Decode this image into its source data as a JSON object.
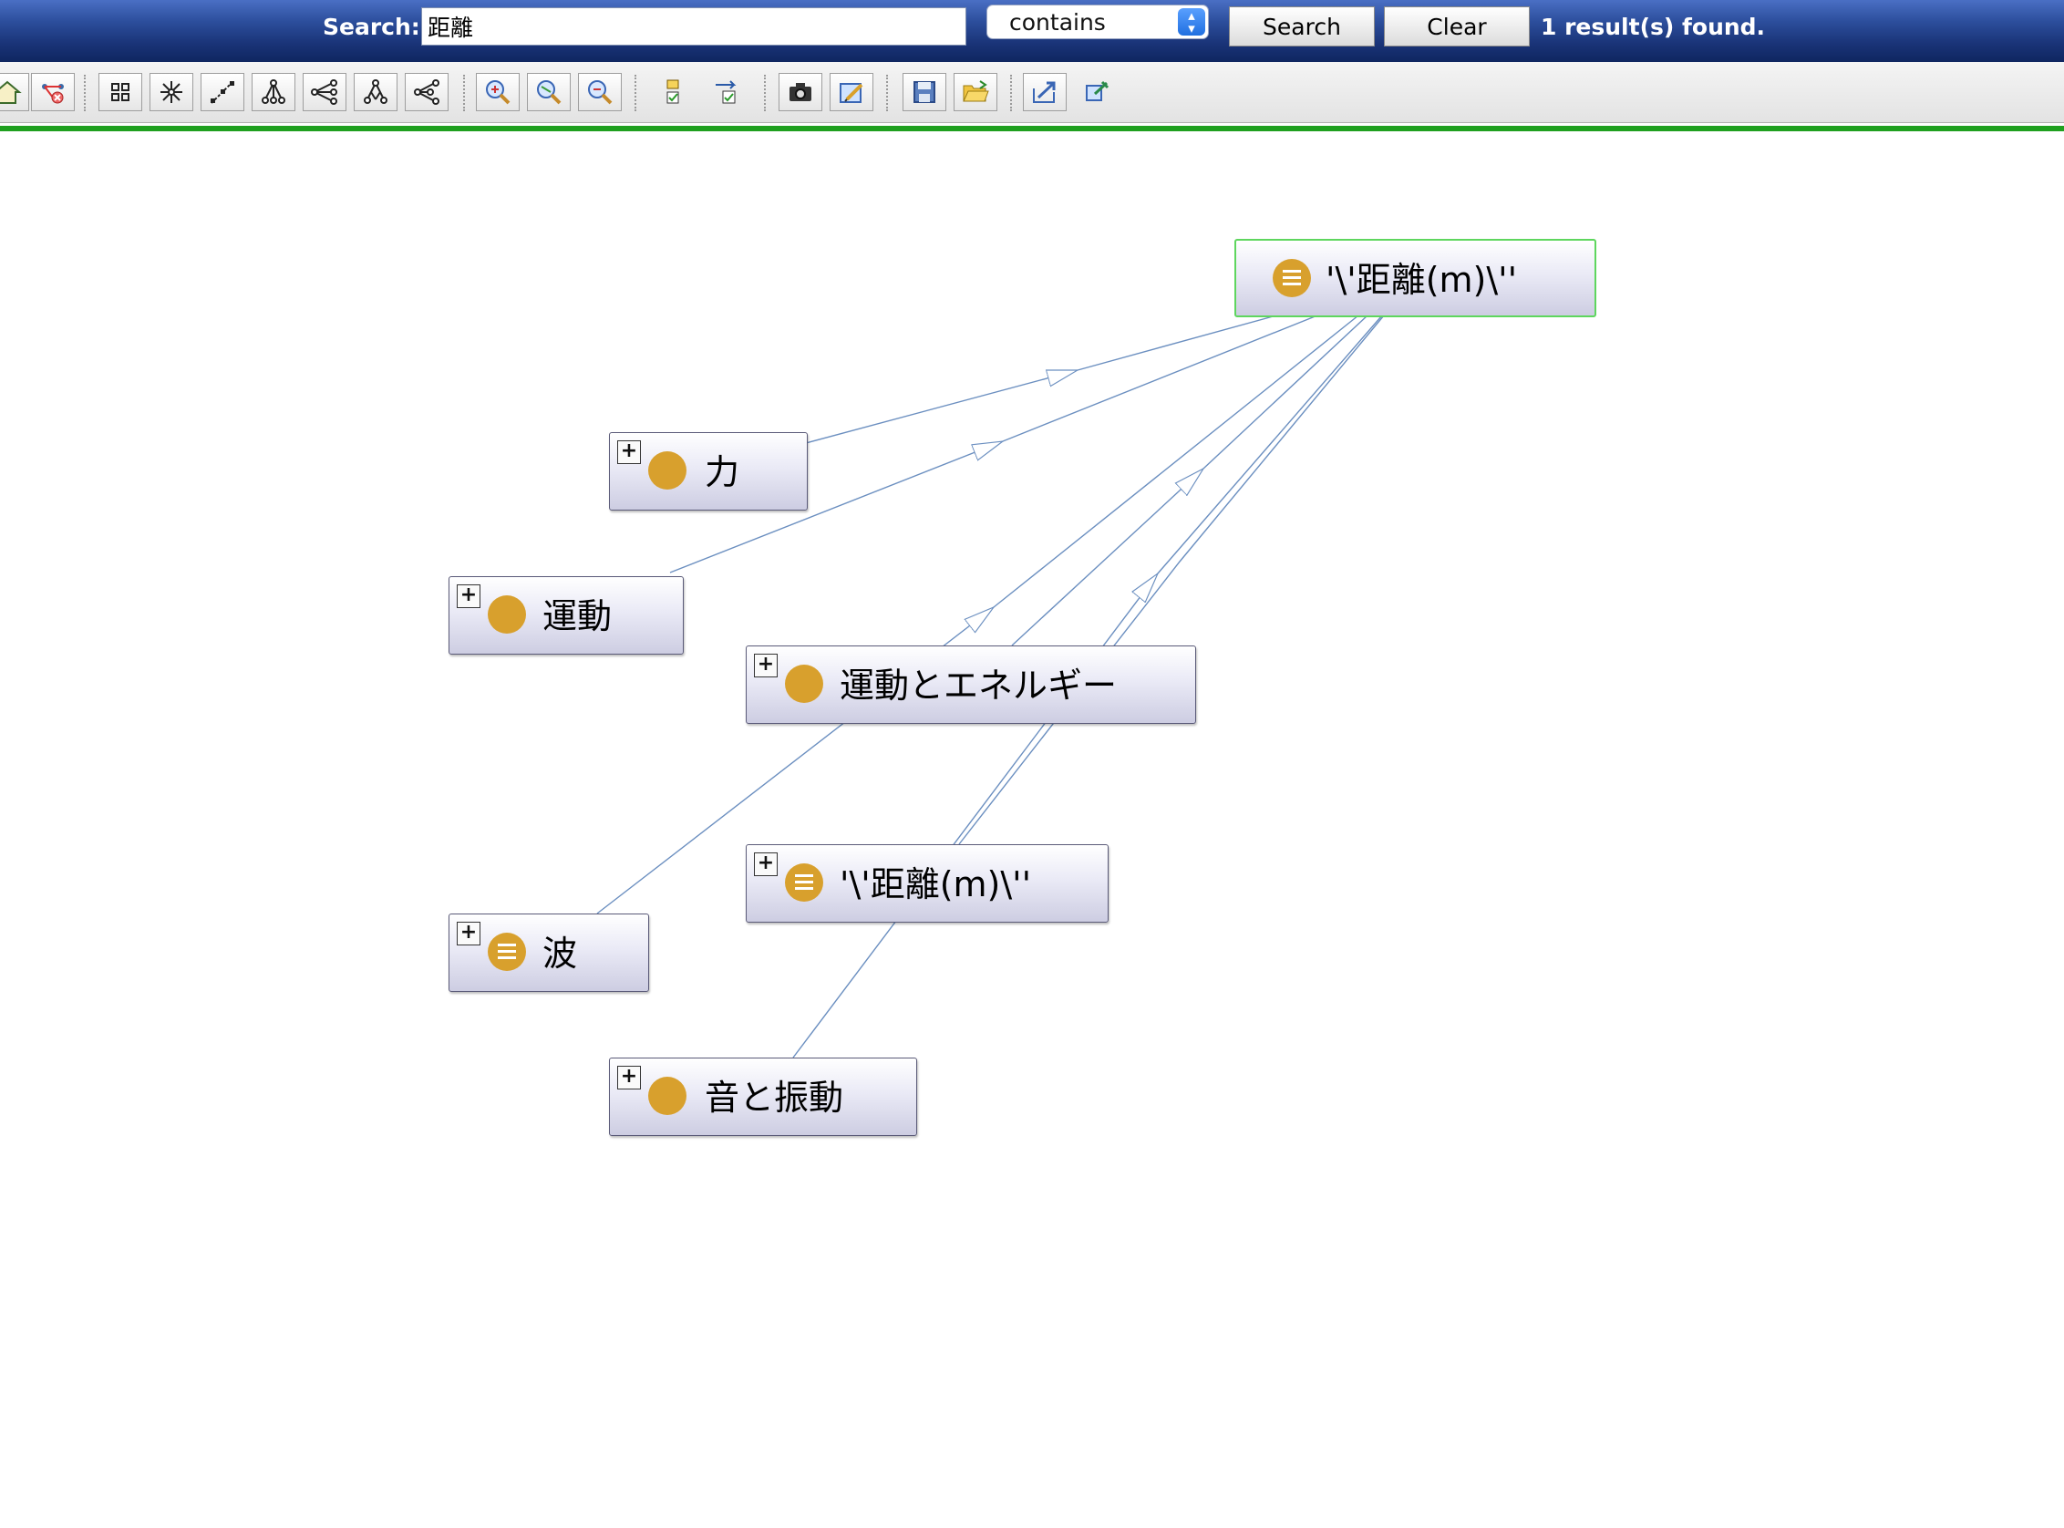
{
  "search": {
    "label": "Search:",
    "value": "距離",
    "mode": "contains",
    "search_button": "Search",
    "clear_button": "Clear",
    "result_text": "1 result(s) found."
  },
  "toolbar": {
    "groups": [
      [
        "home-icon",
        "remove-graph-icon"
      ],
      [
        "grid-layout-icon",
        "spring-layout-icon",
        "diagonal-layout-icon",
        "tree-layout-icon",
        "horizontal-tree-icon",
        "vertical-tree-icon",
        "radial-tree-icon"
      ],
      [
        "zoom-in-icon",
        "zoom-reset-icon",
        "zoom-out-icon"
      ],
      [
        "filter-nodes-icon",
        "filter-edges-icon"
      ],
      [
        "snapshot-camera-icon",
        "edit-icon"
      ],
      [
        "save-icon",
        "open-folder-icon"
      ],
      [
        "export-icon",
        "pin-icon"
      ]
    ]
  },
  "graph": {
    "nodes": [
      {
        "id": "n-target",
        "label": "'\\'距離(m)\\''",
        "icon": "list-circle-icon",
        "selected": true,
        "expandable": false
      },
      {
        "id": "n-chikara",
        "label": "力",
        "icon": "circle-icon",
        "selected": false,
        "expandable": true
      },
      {
        "id": "n-undou",
        "label": "運動",
        "icon": "circle-icon",
        "selected": false,
        "expandable": true
      },
      {
        "id": "n-undou-energy",
        "label": "運動とエネルギー",
        "icon": "circle-icon",
        "selected": false,
        "expandable": true
      },
      {
        "id": "n-kyori2",
        "label": "'\\'距離(m)\\''",
        "icon": "list-circle-icon",
        "selected": false,
        "expandable": true
      },
      {
        "id": "n-nami",
        "label": "波",
        "icon": "list-circle-icon",
        "selected": false,
        "expandable": true
      },
      {
        "id": "n-oto",
        "label": "音と振動",
        "icon": "circle-icon",
        "selected": false,
        "expandable": true
      }
    ],
    "edges": [
      {
        "from": "n-chikara",
        "to": "n-target"
      },
      {
        "from": "n-undou",
        "to": "n-target"
      },
      {
        "from": "n-nami",
        "to": "n-target"
      },
      {
        "from": "n-undou-energy",
        "to": "n-target"
      },
      {
        "from": "n-oto",
        "to": "n-target"
      },
      {
        "from": "n-kyori2",
        "to": "n-target"
      }
    ],
    "colors": {
      "edge": "#6b8fc0",
      "node_icon": "#d8a02d",
      "selected_border": "#5ed65e",
      "accent_line": "#1fa01f"
    }
  }
}
